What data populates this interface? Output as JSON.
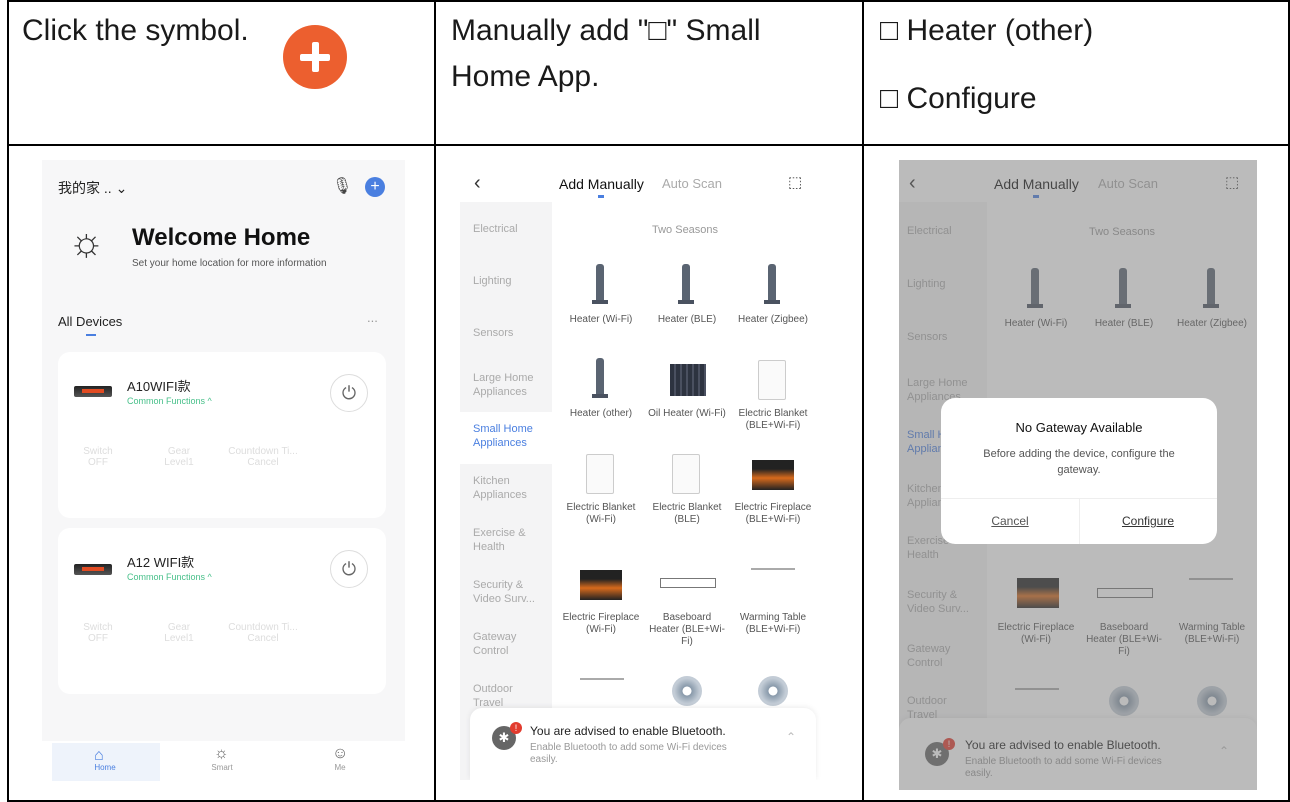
{
  "row1": {
    "c1": "Click the symbol.",
    "c2": "Manually add \"□\" Small Home App.",
    "c3a": "□ Heater (other)",
    "c3b": "□ Configure"
  },
  "phone1": {
    "home_name": "我的家 ..",
    "welcome": "Welcome Home",
    "welcome_sub": "Set your home location for more information",
    "all_devices": "All Devices",
    "more": "...",
    "devices": [
      {
        "name": "A10WIFI款",
        "sub": "Common Functions ^",
        "f1": "Switch",
        "f1s": "OFF",
        "f2": "Gear",
        "f2s": "Level1",
        "f3": "Countdown Ti...",
        "f3s": "Cancel"
      },
      {
        "name": "A12 WIFI款",
        "sub": "Common Functions ^",
        "f1": "Switch",
        "f1s": "OFF",
        "f2": "Gear",
        "f2s": "Level1",
        "f3": "Countdown Ti...",
        "f3s": "Cancel"
      }
    ],
    "tabs": [
      "Home",
      "Smart",
      "Me"
    ]
  },
  "catalog": {
    "tab_manual": "Add Manually",
    "tab_auto": "Auto Scan",
    "section": "Two Seasons",
    "categories": [
      "Electrical",
      "Lighting",
      "Sensors",
      "Large Home Appliances",
      "Small Home Appliances",
      "Kitchen Appliances",
      "Exercise & Health",
      "Security & Video Surv...",
      "Gateway Control",
      "Outdoor Travel"
    ],
    "items": [
      "Heater (Wi-Fi)",
      "Heater (BLE)",
      "Heater (Zigbee)",
      "Heater (other)",
      "Oil Heater (Wi-Fi)",
      "Electric Blanket (BLE+Wi-Fi)",
      "Electric Blanket (Wi-Fi)",
      "Electric Blanket (BLE)",
      "Electric Fireplace (BLE+Wi-Fi)",
      "Electric Fireplace (Wi-Fi)",
      "Baseboard Heater (BLE+Wi-Fi)",
      "Warming Table (BLE+Wi-Fi)"
    ],
    "bt_title": "You are advised to enable Bluetooth.",
    "bt_sub": "Enable Bluetooth to add some Wi-Fi devices easily."
  },
  "dialog": {
    "title": "No Gateway Available",
    "body": "Before adding the device, configure the gateway.",
    "cancel": "Cancel",
    "configure": "Configure"
  },
  "colors": {
    "accent": "#ec5f2f",
    "blue": "#4a7fe0",
    "green": "#48c08a"
  }
}
